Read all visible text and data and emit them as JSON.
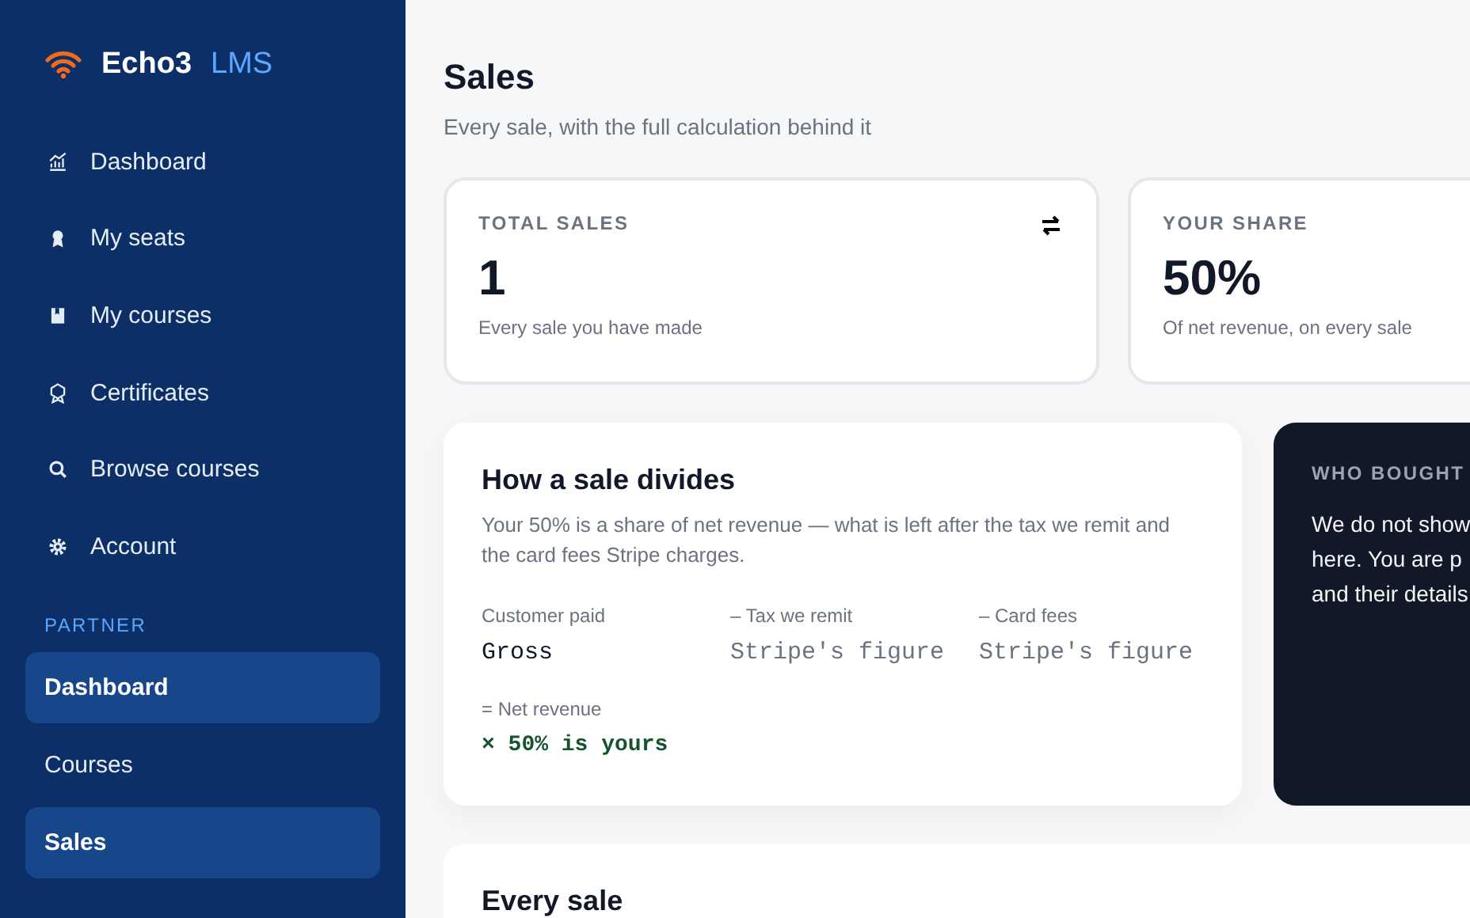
{
  "brand": {
    "name": "Echo3",
    "suffix": "LMS"
  },
  "nav": [
    {
      "label": "Dashboard"
    },
    {
      "label": "My seats"
    },
    {
      "label": "My courses"
    },
    {
      "label": "Certificates"
    },
    {
      "label": "Browse courses"
    },
    {
      "label": "Account"
    }
  ],
  "partner": {
    "heading": "PARTNER",
    "items": [
      {
        "label": "Dashboard",
        "selected": true
      },
      {
        "label": "Courses",
        "selected": false
      },
      {
        "label": "Sales",
        "selected": true
      }
    ]
  },
  "page": {
    "title": "Sales",
    "subtitle": "Every sale, with the full calculation behind it"
  },
  "stats": [
    {
      "label": "TOTAL SALES",
      "value": "1",
      "note": "Every sale you have made"
    },
    {
      "label": "YOUR SHARE",
      "value": "50%",
      "note": "Of net revenue, on every sale"
    }
  ],
  "division": {
    "title": "How a sale divides",
    "text": "Your 50% is a share of net revenue — what is left after the tax we remit and the card fees Stripe charges.",
    "steps": [
      {
        "label": "Customer paid",
        "value": "Gross",
        "kind": "main"
      },
      {
        "label": "– Tax we remit",
        "value": "Stripe's figure",
        "kind": "muted"
      },
      {
        "label": "– Card fees",
        "value": "Stripe's figure",
        "kind": "muted"
      }
    ],
    "result": {
      "label": "= Net revenue",
      "value": "× 50% is yours"
    }
  },
  "buyers": {
    "heading": "WHO BOUGHT",
    "lines": [
      "We do not show",
      "here. You are p",
      "and their details"
    ]
  },
  "sales": {
    "title": "Every sale"
  }
}
